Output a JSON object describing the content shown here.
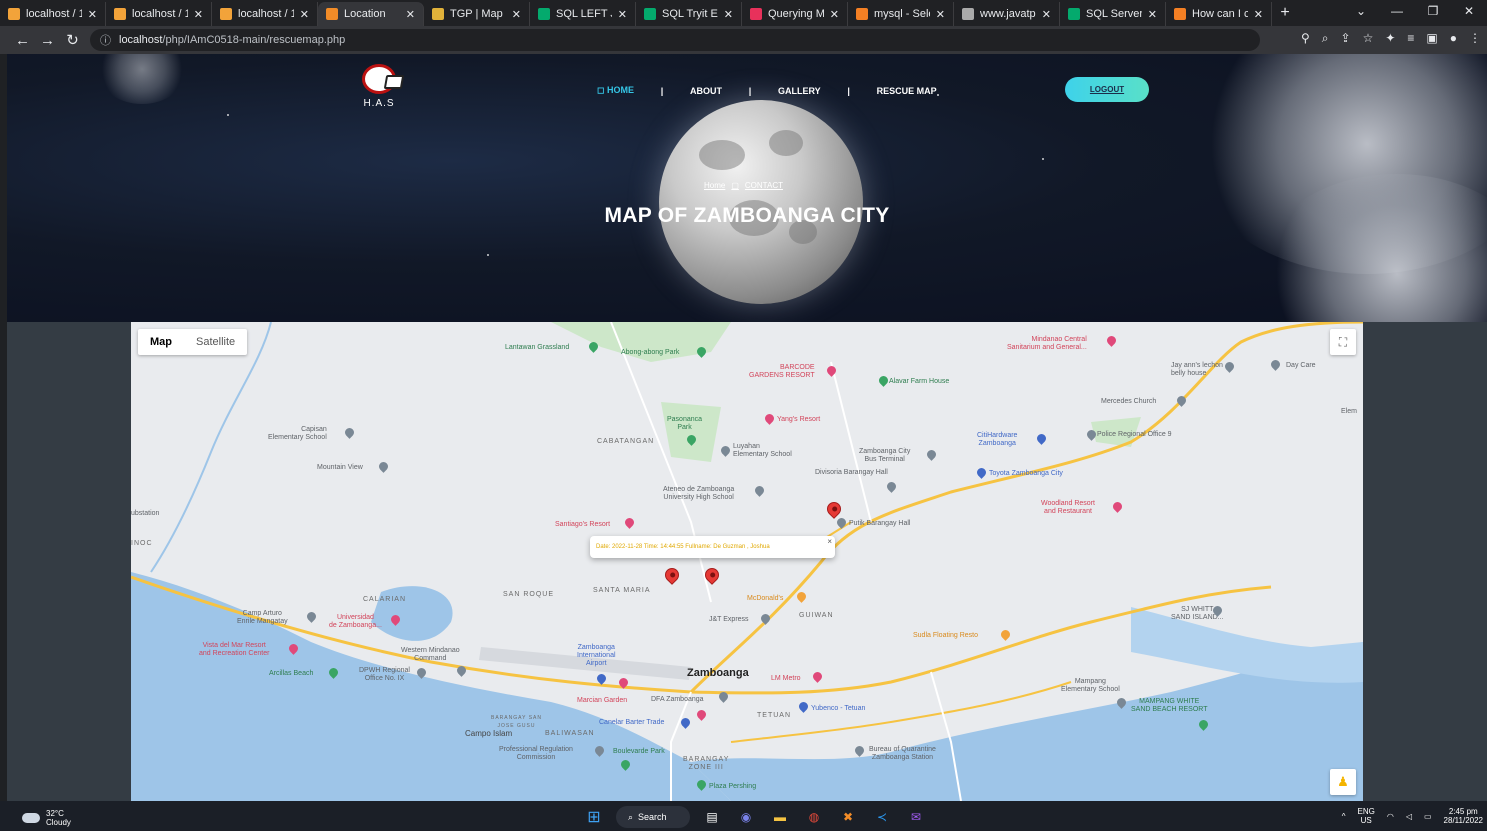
{
  "browser": {
    "tabs": [
      {
        "label": "localhost / 1",
        "icon": "phpmyadmin-icon",
        "color": "#f2a33a"
      },
      {
        "label": "localhost / 1",
        "icon": "phpmyadmin-icon",
        "color": "#f2a33a"
      },
      {
        "label": "localhost / 1",
        "icon": "phpmyadmin-icon",
        "color": "#f2a33a"
      },
      {
        "label": "Location",
        "icon": "page-icon",
        "color": "#f28c28"
      },
      {
        "label": "TGP | Map",
        "icon": "map-site-icon",
        "color": "#e1b23a"
      },
      {
        "label": "SQL LEFT JOI",
        "icon": "w3schools-icon",
        "color": "#04aa6d"
      },
      {
        "label": "SQL Tryit Edit",
        "icon": "w3schools-icon",
        "color": "#04aa6d"
      },
      {
        "label": "Querying Mu",
        "icon": "site-icon",
        "color": "#e8315b"
      },
      {
        "label": "mysql - Selec",
        "icon": "stackoverflow-icon",
        "color": "#f48024"
      },
      {
        "label": "www.javatpo",
        "icon": "globe-icon",
        "color": "#aaaaaa"
      },
      {
        "label": "SQL Server C",
        "icon": "w3schools-icon",
        "color": "#04aa6d"
      },
      {
        "label": "How can I co",
        "icon": "stackoverflow-icon",
        "color": "#f48024"
      }
    ],
    "new_tab": "+",
    "url_host": "localhost",
    "url_path": "/php/IAmC0518-main/rescuemap.php"
  },
  "site": {
    "logo_text": "H.A.S",
    "nav": [
      {
        "label": "HOME",
        "active": true
      },
      {
        "label": "ABOUT",
        "active": false
      },
      {
        "label": "GALLERY",
        "active": false
      },
      {
        "label": "RESCUE MAP",
        "active": false
      }
    ],
    "nav_separator": "|",
    "logout_label": "LOGOUT",
    "breadcrumb": {
      "home": "Home",
      "current": "CONTACT"
    },
    "title": "MAP OF ZAMBOANGA CITY"
  },
  "map": {
    "type_map": "Map",
    "type_satellite": "Satellite",
    "info_window": "Date: 2022-11-28 Time: 14:44:55 Fullname: De Guzman , Joshua",
    "labels": {
      "lantawan": "Lantawan Grassland",
      "abong": "Abong-abong Park",
      "barcode": "BARCODE\nGARDENS RESORT",
      "alavar": "Alavar Farm House",
      "mindanao_central": "Mindanao Central\nSanitarium and General...",
      "jay_ann": "Jay ann's lechon\nbelly house",
      "day_care": "Day Care",
      "mercedes": "Mercedes Church",
      "capisan": "Capisan\nElementary School",
      "pasonanca": "Pasonanca\nPark",
      "yangs": "Yang's Resort",
      "cabatangan": "CABATANGAN",
      "luyahan": "Luyahan\nElementary School",
      "zc_bus": "Zamboanga City\nBus Terminal",
      "citihardware": "CitiHardware\nZamboanga",
      "police": "Police Regional Office 9",
      "mountain_view": "Mountain View",
      "divisoria": "Divisoria Barangay Hall",
      "toyota": "Toyota Zamboanga City",
      "ateneo": "Ateneo de Zamboanga\nUniversity High School",
      "putik": "Putik Barangay Hall",
      "woodland": "Woodland Resort\nand Restaurant",
      "substation": "ubstation",
      "inoc": "INOC",
      "santiagos": "Santiago's Resort",
      "san_roque": "SAN ROQUE",
      "santa_maria": "SANTA MARIA",
      "mcdonalds": "McDonald's",
      "calarian": "CALARIAN",
      "camp_arturo": "Camp Arturo\nEnrile Mangatay",
      "universidad": "Universidad\nde Zamboanga...",
      "jt_express": "J&T Express",
      "guiwan": "GUIWAN",
      "sjwhitt": "SJ WHITT\nSAND ISLAND...",
      "vista_del_mar": "Vista del Mar Resort\nand Recreation Center",
      "western_mindanao": "Western Mindanao\nCommand",
      "zc_airport": "Zamboanga\nInternational\nAirport",
      "sudla": "Sudla Floating Resto",
      "arcillas": "Arcillas Beach",
      "dpwh": "DPWH Regional\nOffice No. IX",
      "zamboanga": "Zamboanga",
      "lm_metro": "LM Metro",
      "mampang_school": "Mampang\nElementary School",
      "mampang_white": "MAMPANG WHITE\nSAND BEACH RESORT",
      "marcian": "Marcian Garden",
      "dfa": "DFA Zamboanga",
      "yubenco": "Yubenco - Tetuan",
      "tetuan": "TETUAN",
      "campo_islam": "Campo Islam",
      "baliwasan": "BALIWASAN",
      "bgy_san_jose": "BARANGAY SAN\nJOSE GUSU",
      "canelar": "Canelar Barter Trade",
      "prc": "Professional Regulation\nCommission",
      "boulevarde": "Boulevarde Park",
      "bgy_zone_iii": "BARANGAY\nZONE III",
      "bureau": "Bureau of Quarantine\nZamboanga Station",
      "plaza": "Plaza Pershing",
      "elem": "Elem"
    }
  },
  "taskbar": {
    "temperature": "32°C",
    "condition": "Cloudy",
    "search_label": "Search",
    "lang_top": "ENG",
    "lang_bottom": "US",
    "time": "2:45 pm",
    "date": "28/11/2022"
  }
}
